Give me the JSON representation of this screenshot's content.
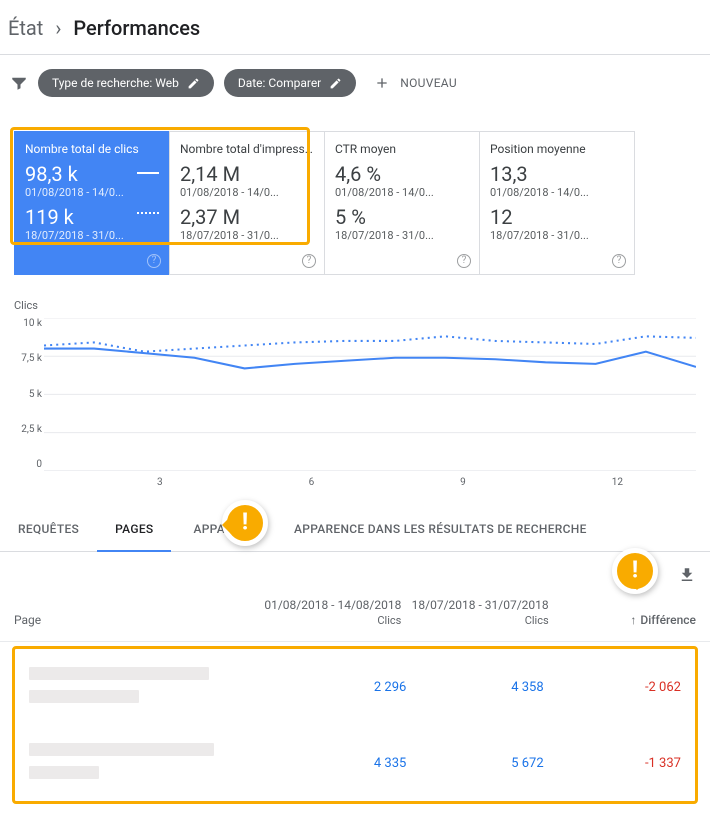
{
  "breadcrumb": {
    "root": "État",
    "current": "Performances"
  },
  "filters": {
    "chip1": "Type de recherche: Web",
    "chip2": "Date: Comparer",
    "new": "NOUVEAU"
  },
  "metrics": [
    {
      "title": "Nombre total de clics",
      "v1": "98,3 k",
      "d1": "01/08/2018 - 14/0...",
      "v2": "119 k",
      "d2": "18/07/2018 - 31/0...",
      "active": true
    },
    {
      "title": "Nombre total d'impressi...",
      "v1": "2,14 M",
      "d1": "01/08/2018 - 14/0...",
      "v2": "2,37 M",
      "d2": "18/07/2018 - 31/0..."
    },
    {
      "title": "CTR moyen",
      "v1": "4,6 %",
      "d1": "01/08/2018 - 14/0...",
      "v2": "5 %",
      "d2": "18/07/2018 - 31/0..."
    },
    {
      "title": "Position moyenne",
      "v1": "13,3",
      "d1": "01/08/2018 - 14/0...",
      "v2": "12",
      "d2": "18/07/2018 - 31/0..."
    }
  ],
  "chart_data": {
    "type": "line",
    "title": "Clics",
    "ylabel": "",
    "xlabel": "",
    "ylim": [
      0,
      10000
    ],
    "yticks": [
      "10 k",
      "7,5 k",
      "5 k",
      "2,5 k",
      "0"
    ],
    "x": [
      1,
      2,
      3,
      4,
      5,
      6,
      7,
      8,
      9,
      10,
      11,
      12,
      13,
      14
    ],
    "xticks": [
      "3",
      "6",
      "9",
      "12"
    ],
    "series": [
      {
        "name": "01/08/2018 - 14/08/2018",
        "style": "solid",
        "values": [
          8000,
          8000,
          7700,
          7400,
          6700,
          7000,
          7200,
          7400,
          7400,
          7300,
          7100,
          7000,
          7800,
          6800
        ]
      },
      {
        "name": "18/07/2018 - 31/07/2018",
        "style": "dotted",
        "values": [
          8200,
          8400,
          7800,
          8000,
          8200,
          8400,
          8500,
          8500,
          8800,
          8500,
          8400,
          8300,
          8800,
          8700
        ]
      }
    ]
  },
  "tabs": {
    "t1": "REQUÊTES",
    "t2": "PAGES",
    "t3": "",
    "t4": "APPAREILS",
    "t5": "APPARENCE DANS LES RÉSULTATS DE RECHERCHE"
  },
  "table": {
    "h_page": "Page",
    "h_p1": "01/08/2018 - 14/08/2018",
    "h_p2": "18/07/2018 - 31/07/2018",
    "h_sub": "Clics",
    "h_diff": "Différence",
    "rows": [
      {
        "c1": "2 296",
        "c2": "4 358",
        "diff": "-2 062"
      },
      {
        "c1": "4 335",
        "c2": "5 672",
        "diff": "-1 337"
      }
    ]
  }
}
